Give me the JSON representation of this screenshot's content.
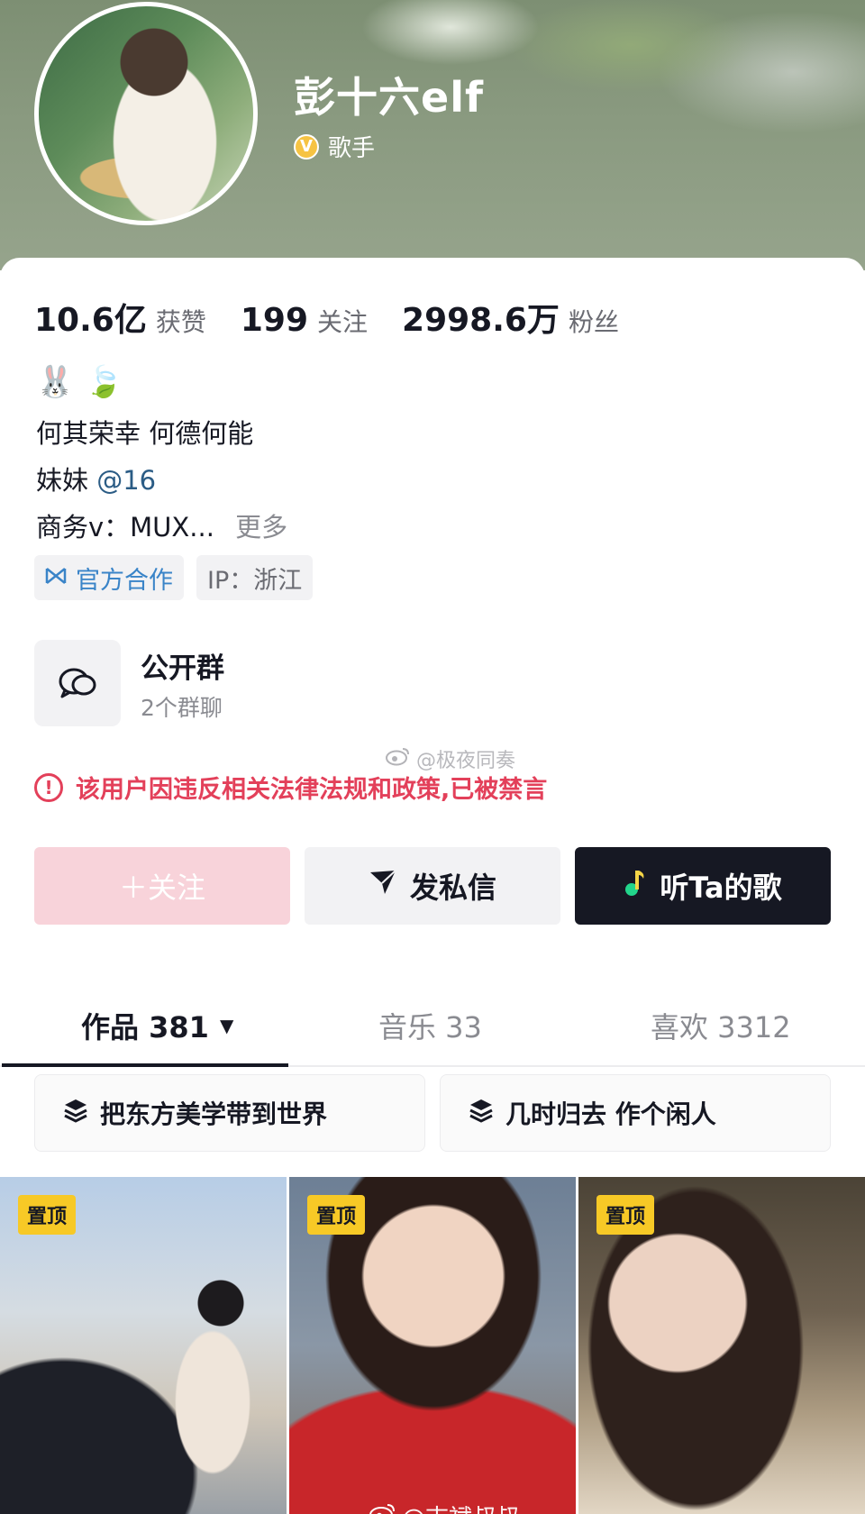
{
  "profile": {
    "name": "彭十六elf",
    "verified_badge": "V",
    "verified_title": "歌手"
  },
  "stats": [
    {
      "value": "10.6亿",
      "label": "获赞"
    },
    {
      "value": "199",
      "label": "关注"
    },
    {
      "value": "2998.6万",
      "label": "粉丝"
    }
  ],
  "bio": {
    "emojis": [
      "🐰",
      "🍃"
    ],
    "line1": "何其荣幸 何德何能",
    "line2_prefix": "妹妹",
    "line2_mention": "@16",
    "line3": "商务v：MUX...",
    "more": "更多"
  },
  "tags": {
    "official": "官方合作",
    "ip": "IP：浙江"
  },
  "group": {
    "title": "公开群",
    "subtitle": "2个群聊"
  },
  "watermarks": {
    "top": "@极夜同奏",
    "bottom": "@志斌叔叔"
  },
  "warning": {
    "icon": "!",
    "text": "该用户因违反相关法律法规和政策,已被禁言"
  },
  "actions": {
    "follow": "＋关注",
    "message": "发私信",
    "listen": "听Ta的歌"
  },
  "tabs": [
    {
      "label": "作品 381",
      "active": true
    },
    {
      "label": "音乐 33",
      "active": false
    },
    {
      "label": "喜欢 3312",
      "active": false
    }
  ],
  "collections": [
    "把东方美学带到世界",
    "几时归去 作个闲人"
  ],
  "videos": [
    {
      "badge": "置顶"
    },
    {
      "badge": "置顶"
    },
    {
      "badge": "置顶"
    }
  ],
  "colors": {
    "warning": "#e3405a",
    "follow_button": "#f8d3da",
    "listen_button": "#161823",
    "pin_badge": "#f7c926",
    "mention": "#2b5c85"
  }
}
